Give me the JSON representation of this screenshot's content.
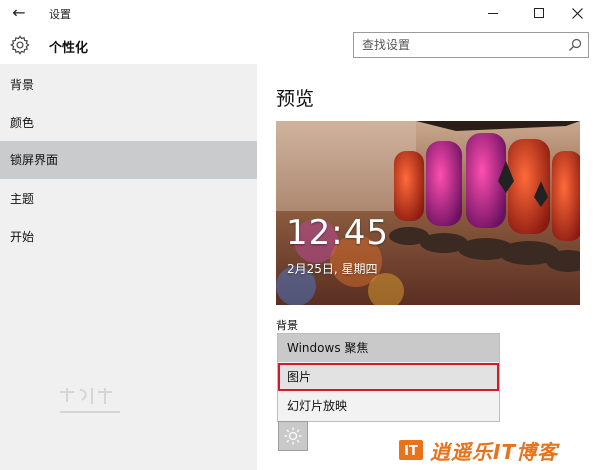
{
  "window": {
    "title": "设置",
    "back_icon": "back-arrow-icon",
    "controls": [
      "minimize-icon",
      "maximize-icon",
      "close-icon"
    ]
  },
  "header": {
    "icon": "gear-icon",
    "title": "个性化",
    "search_placeholder": "查找设置",
    "search_value": "",
    "search_icon": "search-icon"
  },
  "sidebar": {
    "items": [
      {
        "label": "背景",
        "selected": false
      },
      {
        "label": "颜色",
        "selected": false
      },
      {
        "label": "锁屏界面",
        "selected": true
      },
      {
        "label": "主题",
        "selected": false
      },
      {
        "label": "开始",
        "selected": false
      }
    ]
  },
  "main": {
    "preview_title": "预览",
    "preview": {
      "time": "12:45",
      "date": "2月25日, 星期四"
    },
    "background_label": "背景",
    "background_dropdown": {
      "selected": "Windows 聚焦",
      "options": [
        "Windows 聚焦",
        "图片",
        "幻灯片放映"
      ],
      "highlighted": "图片"
    },
    "app_icon": "brightness-icon"
  },
  "watermark": {
    "brand": "逍遥乐IT博客",
    "logo_icon": "it-logo-icon"
  },
  "colors": {
    "sidebar_bg": "#f0f0f0",
    "sidebar_selected": "#c9cbcd",
    "dropdown_selected": "#c9c9c9",
    "highlight_border": "#d11a2a",
    "brand_orange": "#e8731b"
  }
}
